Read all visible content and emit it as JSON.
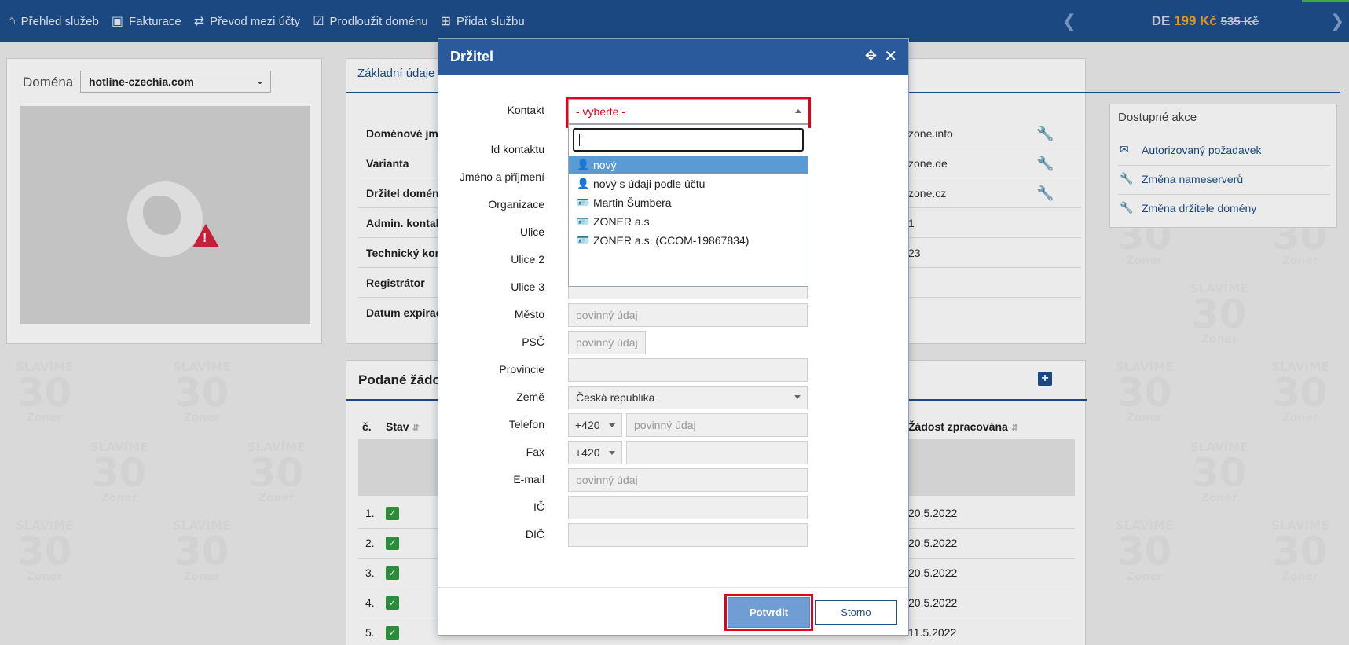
{
  "nav": {
    "items": [
      {
        "label": "Přehled služeb",
        "icon": "home-icon"
      },
      {
        "label": "Fakturace",
        "icon": "money-icon"
      },
      {
        "label": "Převod mezi účty",
        "icon": "transfer-icon"
      },
      {
        "label": "Prodloužit doménu",
        "icon": "calendar-check-icon"
      },
      {
        "label": "Přidat službu",
        "icon": "plus-square-icon"
      }
    ],
    "promo_tld": "DE",
    "promo_price": "199 Kč",
    "promo_old_price": "535 Kč"
  },
  "left": {
    "domain_label": "Doména",
    "domain_value": "hotline-czechia.com"
  },
  "info": {
    "tab_label": "Základní údaje",
    "rows": [
      {
        "label": "Doménové jmé",
        "value": "zone.info"
      },
      {
        "label": "Varianta",
        "value": "zone.de"
      },
      {
        "label": "Držitel domén",
        "value": "zone.cz"
      },
      {
        "label": "Admin. kontak",
        "value": "1"
      },
      {
        "label": "Technický kon",
        "value": "23"
      },
      {
        "label": "Registrátor",
        "value": ""
      },
      {
        "label": "Datum expirac",
        "value": ""
      }
    ]
  },
  "actions": {
    "title": "Dostupné akce",
    "items": [
      {
        "label": "Autorizovaný požadavek",
        "icon": "envelope-icon"
      },
      {
        "label": "Změna nameserverů",
        "icon": "wrench-icon"
      },
      {
        "label": "Změna držitele domény",
        "icon": "wrench-icon"
      }
    ]
  },
  "requests": {
    "title": "Podané žádos",
    "col_num": "č.",
    "col_state": "Stav",
    "col_processed": "Žádost zpracována",
    "rows": [
      {
        "num": "1.",
        "date": "20.5.2022"
      },
      {
        "num": "2.",
        "date": "20.5.2022"
      },
      {
        "num": "3.",
        "date": "20.5.2022"
      },
      {
        "num": "4.",
        "date": "20.5.2022"
      },
      {
        "num": "5.",
        "date": "11.5.2022"
      }
    ]
  },
  "watermark": {
    "top": "SLAVÍME",
    "num": "30",
    "brand": "Zoner"
  },
  "modal": {
    "title": "Držitel",
    "fields": {
      "kontakt": "Kontakt",
      "id": "Id kontaktu",
      "name": "Jméno a příjmení",
      "org": "Organizace",
      "street": "Ulice",
      "street2": "Ulice 2",
      "street3": "Ulice 3",
      "city": "Město",
      "zip": "PSČ",
      "province": "Provincie",
      "country": "Země",
      "phone": "Telefon",
      "fax": "Fax",
      "email": "E-mail",
      "ic": "IČ",
      "dic": "DIČ"
    },
    "required_placeholder": "povinný údaj",
    "contact_selected": "- vyberte -",
    "contact_options": [
      {
        "label": "nový",
        "icon": "user-plus-icon"
      },
      {
        "label": "nový s údaji podle účtu",
        "icon": "user-plus-icon"
      },
      {
        "label": "Martin Šumbera",
        "icon": "id-card-icon"
      },
      {
        "label": "ZONER a.s.",
        "icon": "id-card-icon"
      },
      {
        "label": "ZONER a.s. (CCOM-19867834)",
        "icon": "id-card-icon"
      }
    ],
    "country_value": "Česká republika",
    "phone_code": "+420",
    "fax_code": "+420",
    "confirm_label": "Potvrdit",
    "cancel_label": "Storno"
  }
}
